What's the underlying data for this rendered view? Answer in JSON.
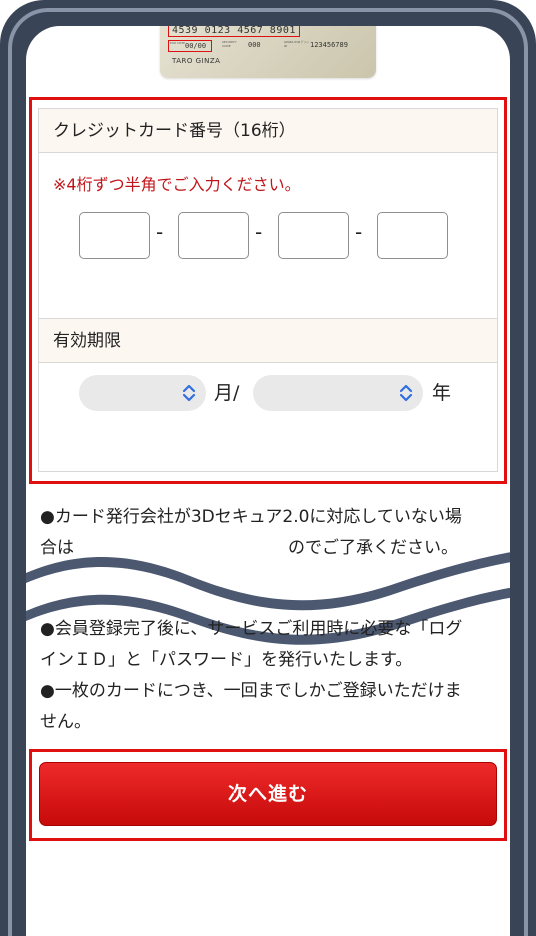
{
  "card_image": {
    "number": "4539 0123 4567 8901",
    "exp_label": "EXP. DATE",
    "exp_value": "00/00",
    "security_label": "SECURITY CODE",
    "security_value": "000",
    "ginza_label": "GINZA ID# ｸﾞﾘｰﾝID",
    "ginza_value": "123456789",
    "holder": "TARO GINZA"
  },
  "card_number_section": {
    "header": "クレジットカード番号（16桁）",
    "note": "※4桁ずつ半角でご入力ください。",
    "separator": "-",
    "fields": [
      "",
      "",
      "",
      ""
    ]
  },
  "expiry_section": {
    "header": "有効期限",
    "month_value": "",
    "month_unit": "月/",
    "year_value": "",
    "year_unit": "年"
  },
  "info": {
    "line1": "●カード発行会社が3Dセキュア2.0に対応していない場",
    "line2": "合は",
    "line2_end": "のでご了承ください。",
    "line3": "●会員登録完了後に、サービスご利用時に必要な「ログ",
    "line4": "インＩＤ」と「パスワード」を発行いたします。",
    "line5": "●一枚のカードにつき、一回までしかご登録いただけま",
    "line6": "せん。"
  },
  "next_button": {
    "label": "次へ進む"
  },
  "colors": {
    "frame": "#3a4457",
    "accent_red": "#e01010",
    "note_red": "#c0161b",
    "header_bg": "#fcf7f0"
  }
}
